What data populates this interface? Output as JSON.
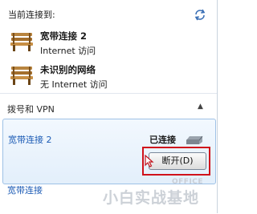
{
  "header": {
    "title": "当前连接到:",
    "refresh_icon": "refresh-icon"
  },
  "connections": [
    {
      "name": "宽带连接 2",
      "subtitle": "Internet 访问",
      "icon": "network-bench-icon"
    },
    {
      "name": "未识别的网络",
      "subtitle": "无 Internet 访问",
      "icon": "network-bench-icon"
    }
  ],
  "dialup_section": {
    "title": "拨号和 VPN",
    "selected": {
      "name": "宽带连接 2",
      "status": "已连接",
      "action_label": "断开(D)"
    },
    "other": {
      "name": "宽带连接"
    }
  },
  "watermark": {
    "main": "小白实战基地",
    "small": "OFFICE"
  },
  "colors": {
    "link": "#1c5bb5",
    "highlight_border": "#d0121b",
    "selected_bg": "#e3effb"
  }
}
